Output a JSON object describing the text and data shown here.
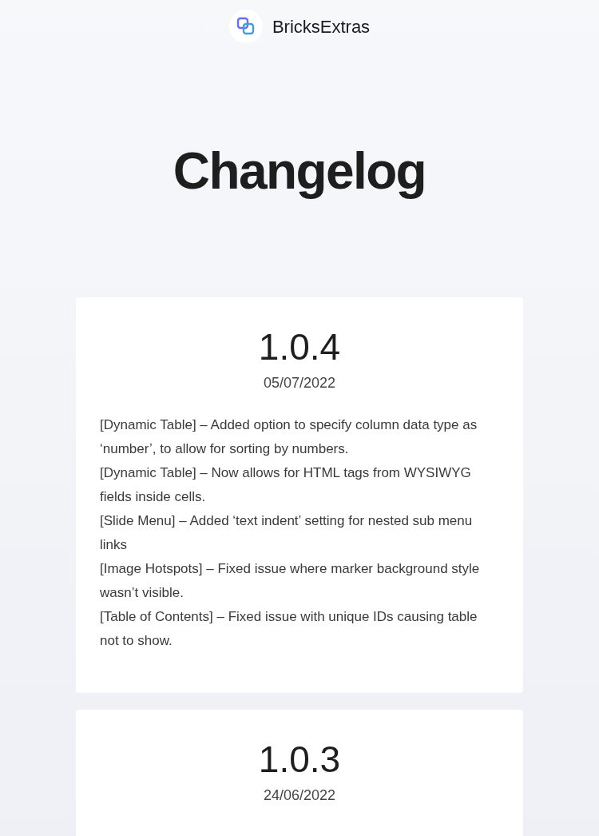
{
  "header": {
    "brand": "BricksExtras"
  },
  "title": "Changelog",
  "releases": [
    {
      "version": "1.0.4",
      "date": "05/07/2022",
      "changes": [
        "[Dynamic Table] – Added option to specify column data type as ‘number’, to allow for sorting by numbers.",
        "[Dynamic Table] – Now allows for HTML tags from WYSIWYG fields inside cells.",
        "[Slide Menu] – Added ‘text indent’ setting for nested sub menu links",
        "[Image Hotspots] – Fixed issue where marker background style wasn’t visible.",
        "[Table of Contents] – Fixed issue with unique IDs causing table not to show."
      ]
    },
    {
      "version": "1.0.3",
      "date": "24/06/2022"
    }
  ]
}
